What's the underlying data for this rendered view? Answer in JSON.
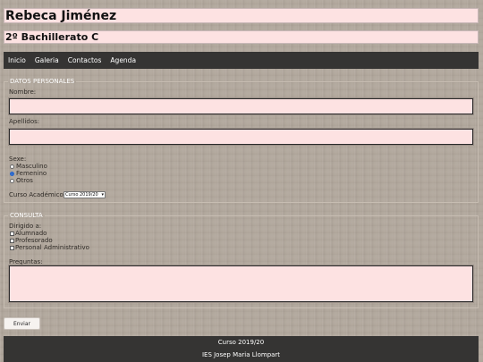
{
  "header": {
    "name": "Rebeca Jiménez",
    "course_group": "2º Bachillerato C"
  },
  "nav": {
    "items": [
      {
        "label": "Inicio"
      },
      {
        "label": "Galeria"
      },
      {
        "label": "Contactos"
      },
      {
        "label": "Agenda"
      }
    ]
  },
  "personal": {
    "legend": "DATOS PERSONALES",
    "nombre_label": "Nombre:",
    "nombre_value": "",
    "apellidos_label": "Apellidos:",
    "apellidos_value": "",
    "sexo_label": "Sexe:",
    "sexo_options": [
      {
        "label": "Masculino",
        "checked": false
      },
      {
        "label": "Femenino",
        "checked": true
      },
      {
        "label": "Otros",
        "checked": false
      }
    ],
    "curso_label": "Curso Académico",
    "curso_selected": "Curso 2019/20"
  },
  "consulta": {
    "legend": "CONSULTA",
    "dirigido_label": "Dirigido a:",
    "dirigido_options": [
      {
        "label": "Alumnado",
        "checked": false
      },
      {
        "label": "Profesorado",
        "checked": false
      },
      {
        "label": "Personal Administrativo",
        "checked": false
      }
    ],
    "preguntas_label": "Preguntas:",
    "preguntas_value": ""
  },
  "form": {
    "submit_label": "Enviar"
  },
  "footer": {
    "line1": "Curso 2019/20",
    "line2": "IES Josep Maria Llompart"
  },
  "colors": {
    "field_bg": "#fde2e2",
    "nav_bg": "#353433",
    "page_bg": "#b1a79c"
  }
}
